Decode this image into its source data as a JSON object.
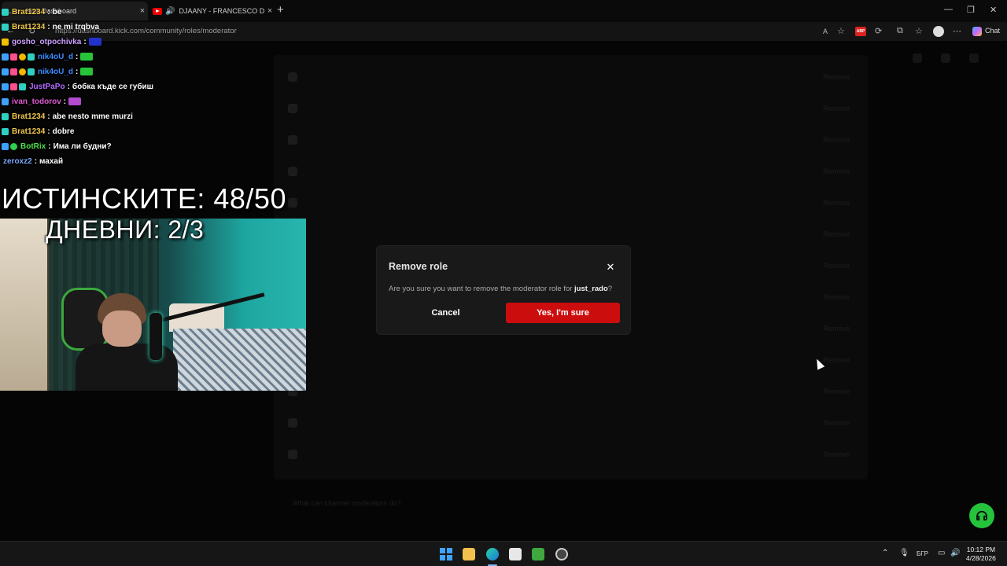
{
  "browser": {
    "tabs": [
      {
        "label": "...or - Kick Dashboard",
        "active": true
      },
      {
        "label": "DJAANY - FRANCESCO DINER",
        "audible": true
      }
    ],
    "url": "https://dashboard.kick.com/community/roles/moderator",
    "copilot_label": "Chat",
    "window_controls": [
      "minimize",
      "restore",
      "close"
    ]
  },
  "modal": {
    "title": "Remove role",
    "message_prefix": "Are you sure you want to remove the moderator role for ",
    "username": "just_rado",
    "message_suffix": "?",
    "cancel_label": "Cancel",
    "confirm_label": "Yes, I'm sure",
    "confirm_color": "#cc0d0d"
  },
  "overlay": {
    "chat": [
      {
        "user": "Brat1234",
        "message": "be",
        "color": "#f2c94c",
        "badges": [
          "teal"
        ]
      },
      {
        "user": "Brat1234",
        "message": "ne mi trqbva",
        "color": "#f2c94c",
        "badges": [
          "teal"
        ]
      },
      {
        "user": "gosho_otpochivka",
        "message": "",
        "color": "#cba0ff",
        "badges": [
          "yellow"
        ],
        "emote": "#2233cc"
      },
      {
        "user": "nik4oU_d",
        "message": "",
        "color": "#3d8bff",
        "badges": [
          "blue",
          "pink",
          "gold",
          "teal"
        ],
        "emote": "#27c43a"
      },
      {
        "user": "nik4oU_d",
        "message": "",
        "color": "#3d8bff",
        "badges": [
          "blue",
          "pink",
          "gold",
          "teal"
        ],
        "emote": "#27c43a"
      },
      {
        "user": "JustPaPo",
        "message": "бобка къде се губиш",
        "color": "#b56bff",
        "badges": [
          "blue",
          "pink",
          "teal"
        ]
      },
      {
        "user": "ivan_todorov",
        "message": "",
        "color": "#e05bd0",
        "badges": [
          "blue"
        ],
        "emote": "#b44cd0"
      },
      {
        "user": "Brat1234",
        "message": "abe nesto mme murzi",
        "color": "#f2c94c",
        "badges": [
          "teal"
        ]
      },
      {
        "user": "Brat1234",
        "message": "dobre",
        "color": "#f2c94c",
        "badges": [
          "teal"
        ]
      },
      {
        "user": "BotRix",
        "message": "Има ли будни?",
        "color": "#4ee04e",
        "badges": [
          "blue",
          "green"
        ]
      },
      {
        "user": "zeroxz2",
        "message": "махай",
        "color": "#7aa8ff",
        "badges": []
      }
    ],
    "counter_main": "ИСТИНСКИТЕ: 48/50",
    "counter_daily": "ДНЕВНИ: 2/3"
  },
  "background_list": {
    "rows": [
      "",
      "",
      "",
      "",
      "",
      "",
      "",
      "",
      "",
      "",
      "",
      "",
      ""
    ],
    "remove_label": "Remove",
    "footer_text": "What can channel moderators do?"
  },
  "taskbar": {
    "language": "БГР",
    "time": "10:12 PM",
    "date": "4/28/2026",
    "apps": [
      "start",
      "file-explorer",
      "edge",
      "store",
      "minecraft",
      "media-app"
    ]
  },
  "icons": {
    "close": "×",
    "support": "headset-icon"
  }
}
